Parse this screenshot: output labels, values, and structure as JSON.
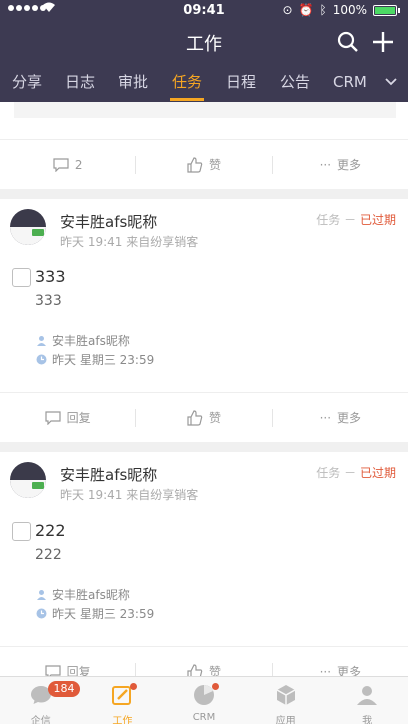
{
  "status_bar": {
    "time": "09:41",
    "battery": "100%"
  },
  "header": {
    "title": "工作",
    "search_icon": "search-icon",
    "add_icon": "plus-icon"
  },
  "tabs": [
    {
      "label": "分享"
    },
    {
      "label": "日志"
    },
    {
      "label": "审批"
    },
    {
      "label": "任务"
    },
    {
      "label": "日程"
    },
    {
      "label": "公告"
    },
    {
      "label": "CRM信"
    }
  ],
  "first_card": {
    "reply_count": "2",
    "like_label": "赞",
    "more_label": "更多"
  },
  "tasks": [
    {
      "user": "安丰胜afs昵称",
      "meta": "昨天 19:41  来自纷享销客",
      "type": "任务",
      "dash": "－",
      "status": "已过期",
      "title": "333",
      "desc": "333",
      "assignee": "安丰胜afs昵称",
      "deadline": "昨天 星期三 23:59",
      "reply_label": "回复",
      "like_label": "赞",
      "more_label": "更多"
    },
    {
      "user": "安丰胜afs昵称",
      "meta": "昨天 19:41  来自纷享销客",
      "type": "任务",
      "dash": "－",
      "status": "已过期",
      "title": "222",
      "desc": "222",
      "assignee": "安丰胜afs昵称",
      "deadline": "昨天 星期三 23:59",
      "reply_label": "回复",
      "like_label": "赞",
      "more_label": "更多"
    }
  ],
  "tabbar": [
    {
      "label": "企信",
      "badge": "184",
      "icon": "chat-icon"
    },
    {
      "label": "工作",
      "icon": "edit-icon"
    },
    {
      "label": "CRM",
      "icon": "pie-chart-icon"
    },
    {
      "label": "应用",
      "icon": "cube-icon"
    },
    {
      "label": "我",
      "icon": "user-icon"
    }
  ],
  "colors": {
    "header_bg": "#3d3a52",
    "accent": "#f5a623",
    "overdue": "#e05a3a"
  }
}
